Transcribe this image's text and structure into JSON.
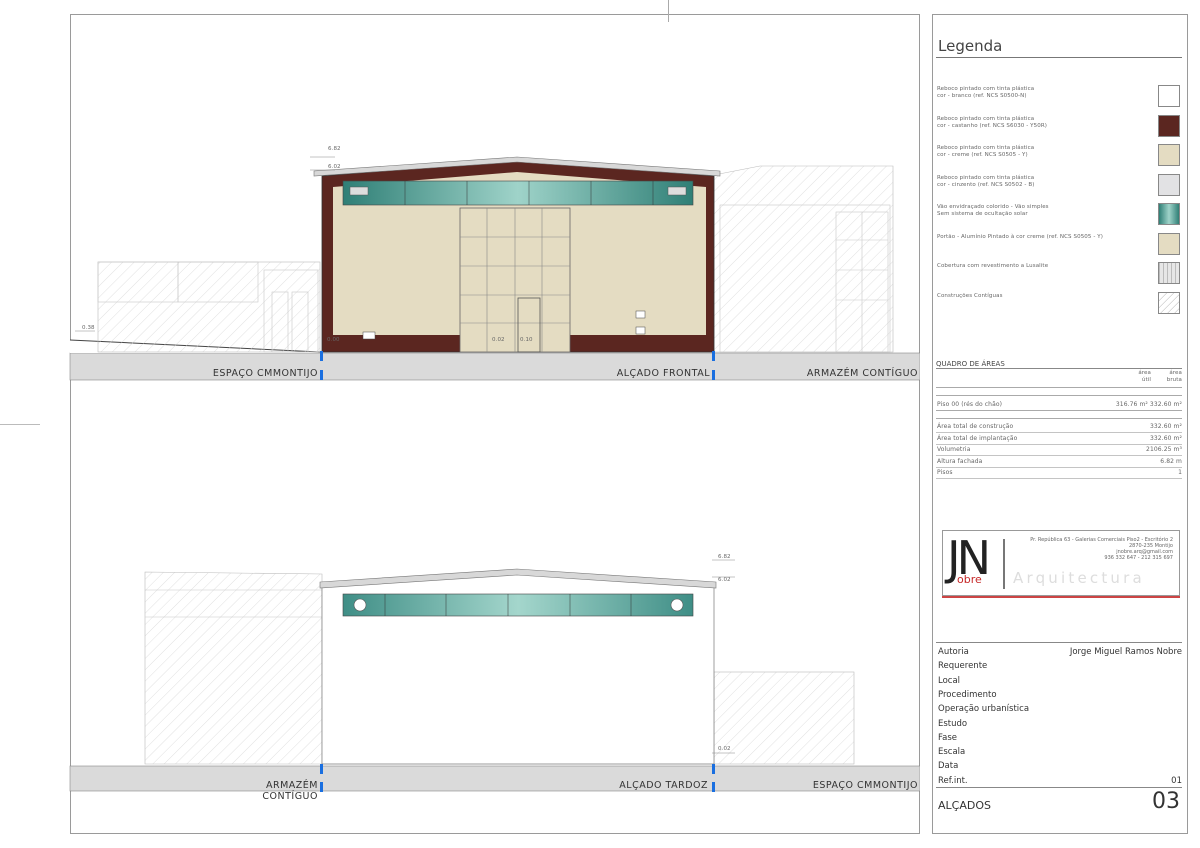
{
  "legend": {
    "title": "Legenda",
    "items": [
      {
        "text": "Reboco pintado com tinta plástica\ncor - branco (ref. NCS S0500-N)",
        "swatch": "white",
        "color": "#ffffff"
      },
      {
        "text": "Reboco pintado com tinta plástica\ncor - castanho (ref. NCS S6030 - Y50R)",
        "swatch": "brown",
        "color": "#5b2620"
      },
      {
        "text": "Reboco pintado com tinta plástica\ncor - creme (ref. NCS S0505 - Y)",
        "swatch": "cream",
        "color": "#e4dcc2"
      },
      {
        "text": "Reboco pintado com tinta plástica\ncor - cinzento (ref. NCS S0502 - B)",
        "swatch": "grey",
        "color": "#e2e2e4"
      },
      {
        "text": "Vão envidraçado colorido - Vão simples\nSem sistema de ocultação solar",
        "swatch": "glass",
        "color": "#5fa89e"
      },
      {
        "text": "Portão - Alumínio Pintado à cor creme (ref. NCS S0505 - Y)",
        "swatch": "gate",
        "color": "#e4dcc2"
      },
      {
        "text": "Cobertura com revestimento a Lusalite",
        "swatch": "roof",
        "color": "#d8d8d8"
      },
      {
        "text": "Construções Contíguas",
        "swatch": "hatch",
        "color": "#ffffff"
      }
    ]
  },
  "areas": {
    "title": "QUADRO DE ÁREAS",
    "col_util": "área\nútil",
    "col_bruta": "área\nbruta",
    "floor_label": "Piso 00 (rés do chão)",
    "floor_values": "316.76 m²  332.60 m²",
    "rows": [
      {
        "label": "Área total de construção",
        "value": "332.60 m²"
      },
      {
        "label": "Área total de implantação",
        "value": "332.60 m²"
      },
      {
        "label": "Volumetria",
        "value": "2106.25 m³"
      },
      {
        "label": "Altura fachada",
        "value": "6.82 m"
      },
      {
        "label": "Pisos",
        "value": "1"
      }
    ]
  },
  "logo": {
    "letters": "JN",
    "sub": "obre",
    "firm": "Arquitectura",
    "address": [
      "Pr. República 63 - Galerias Comerciais Piso2 - Escritório 2",
      "2870-235 Montijo",
      "jnobre.arq@gmail.com",
      "936 332 647 - 212 315 697"
    ]
  },
  "project": {
    "rows": [
      {
        "label": "Autoria",
        "value": "Jorge Miguel Ramos Nobre"
      },
      {
        "label": "Requerente",
        "value": ""
      },
      {
        "label": "Local",
        "value": ""
      },
      {
        "label": "Procedimento",
        "value": ""
      },
      {
        "label": "Operação urbanística",
        "value": ""
      },
      {
        "label": "Estudo",
        "value": ""
      },
      {
        "label": "Fase",
        "value": ""
      },
      {
        "label": "Escala",
        "value": ""
      },
      {
        "label": "Data",
        "value": ""
      },
      {
        "label": "Ref.int.",
        "value": "01"
      }
    ],
    "sheet_title": "ALÇADOS",
    "sheet_number": "03"
  },
  "elevations": {
    "front": {
      "left": "ESPAÇO CMMONTIJO",
      "center": "ALÇADO FRONTAL",
      "right": "ARMAZÉM CONTÍGUO"
    },
    "rear": {
      "left": "ARMAZÉM CONTÍGUO",
      "center": "ALÇADO TARDOZ",
      "right": "ESPAÇO CMMONTIJO"
    }
  },
  "dims": {
    "top": "6.82",
    "eave": "6.02",
    "left": "0.38",
    "floor": "0.00",
    "door_a": "0.02",
    "door_b": "0.10",
    "rear_floor": "0.02"
  }
}
